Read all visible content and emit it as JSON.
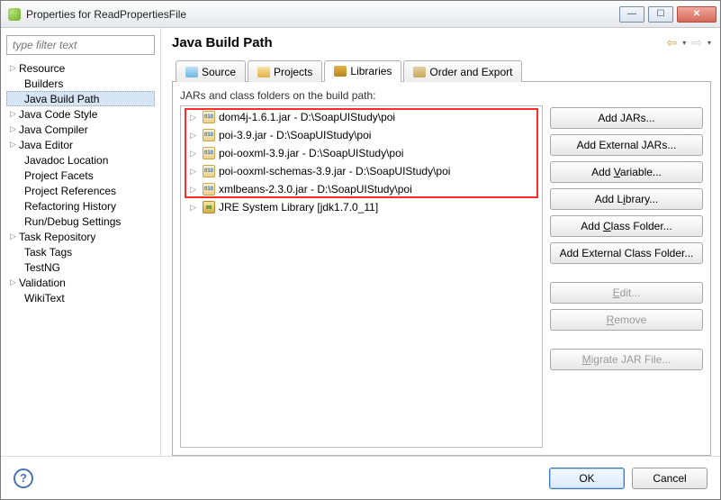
{
  "window": {
    "title": "Properties for ReadPropertiesFile"
  },
  "sidebar": {
    "filter_placeholder": "type filter text",
    "items": [
      {
        "label": "Resource",
        "twisty": true,
        "indent": false
      },
      {
        "label": "Builders",
        "twisty": false,
        "indent": true
      },
      {
        "label": "Java Build Path",
        "twisty": false,
        "indent": true,
        "selected": true
      },
      {
        "label": "Java Code Style",
        "twisty": true,
        "indent": false
      },
      {
        "label": "Java Compiler",
        "twisty": true,
        "indent": false
      },
      {
        "label": "Java Editor",
        "twisty": true,
        "indent": false
      },
      {
        "label": "Javadoc Location",
        "twisty": false,
        "indent": true
      },
      {
        "label": "Project Facets",
        "twisty": false,
        "indent": true
      },
      {
        "label": "Project References",
        "twisty": false,
        "indent": true
      },
      {
        "label": "Refactoring History",
        "twisty": false,
        "indent": true
      },
      {
        "label": "Run/Debug Settings",
        "twisty": false,
        "indent": true
      },
      {
        "label": "Task Repository",
        "twisty": true,
        "indent": false
      },
      {
        "label": "Task Tags",
        "twisty": false,
        "indent": true
      },
      {
        "label": "TestNG",
        "twisty": false,
        "indent": true
      },
      {
        "label": "Validation",
        "twisty": true,
        "indent": false
      },
      {
        "label": "WikiText",
        "twisty": false,
        "indent": true
      }
    ]
  },
  "main": {
    "heading": "Java Build Path",
    "tabs": {
      "source": "Source",
      "projects": "Projects",
      "libraries": "Libraries",
      "order": "Order and Export"
    },
    "desc": "JARs and class folders on the build path:",
    "libs": [
      {
        "label": "dom4j-1.6.1.jar - D:\\SoapUIStudy\\poi",
        "kind": "jar"
      },
      {
        "label": "poi-3.9.jar - D:\\SoapUIStudy\\poi",
        "kind": "jar"
      },
      {
        "label": "poi-ooxml-3.9.jar - D:\\SoapUIStudy\\poi",
        "kind": "jar"
      },
      {
        "label": "poi-ooxml-schemas-3.9.jar - D:\\SoapUIStudy\\poi",
        "kind": "jar"
      },
      {
        "label": "xmlbeans-2.3.0.jar - D:\\SoapUIStudy\\poi",
        "kind": "jar"
      },
      {
        "label": "JRE System Library [jdk1.7.0_11]",
        "kind": "lib"
      }
    ],
    "buttons": {
      "add_jars": "Add JARs...",
      "add_ext_jars": "Add External JARs...",
      "add_variable": "Add Variable...",
      "add_library": "Add Library...",
      "add_class_folder": "Add Class Folder...",
      "add_ext_class_folder": "Add External Class Folder...",
      "edit": "Edit...",
      "remove": "Remove",
      "migrate": "Migrate JAR File..."
    }
  },
  "footer": {
    "ok": "OK",
    "cancel": "Cancel"
  }
}
